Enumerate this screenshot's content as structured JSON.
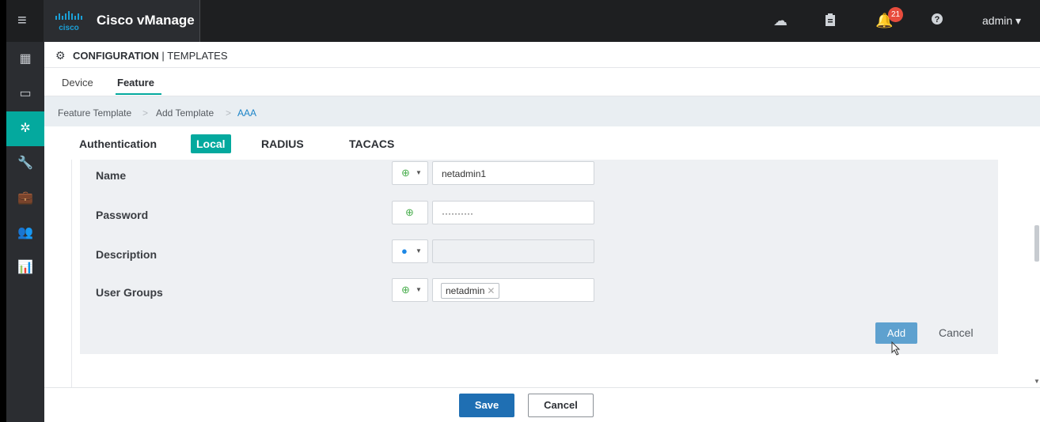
{
  "app": {
    "brand": "Cisco vManage",
    "logo_text": "cisco"
  },
  "topbar": {
    "notifications_count": "21",
    "user": "admin ▾"
  },
  "header": {
    "section": "CONFIGURATION",
    "separator": " | ",
    "subsection": "TEMPLATES"
  },
  "subtabs": [
    {
      "label": "Device"
    },
    {
      "label": "Feature"
    }
  ],
  "breadcrumb": [
    {
      "label": "Feature Template"
    },
    {
      "label": "Add Template"
    },
    {
      "label": "AAA"
    }
  ],
  "breadcrumb_sep": ">",
  "auth_tabs": [
    {
      "label": "Authentication"
    },
    {
      "label": "Local"
    },
    {
      "label": "RADIUS"
    },
    {
      "label": "TACACS"
    }
  ],
  "form": {
    "name": {
      "label": "Name",
      "value": "netadmin1"
    },
    "password": {
      "label": "Password",
      "value": "··········"
    },
    "description": {
      "label": "Description",
      "value": ""
    },
    "user_groups": {
      "label": "User Groups",
      "tag": "netadmin",
      "remove": "✕"
    }
  },
  "actions": {
    "add": "Add",
    "cancel": "Cancel"
  },
  "footer": {
    "save": "Save",
    "cancel": "Cancel"
  },
  "colors": {
    "accent": "#04a99e",
    "primary": "#1f6fb3",
    "link": "#1d85c8"
  }
}
